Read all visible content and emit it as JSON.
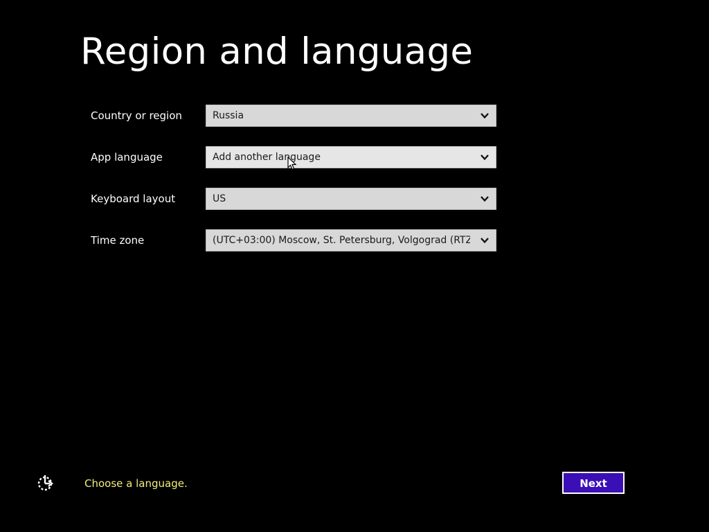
{
  "page": {
    "title": "Region and language"
  },
  "form": {
    "fields": [
      {
        "label": "Country or region",
        "value": "Russia"
      },
      {
        "label": "App language",
        "value": "Add another language"
      },
      {
        "label": "Keyboard layout",
        "value": "US"
      },
      {
        "label": "Time zone",
        "value": "(UTC+03:00) Moscow, St. Petersburg, Volgograd (RTZ..."
      }
    ]
  },
  "footer": {
    "status_text": "Choose a language.",
    "next_label": "Next",
    "ease_of_access_icon": "ease-of-access-icon"
  },
  "colors": {
    "background": "#000000",
    "status_text": "#f2ee7c",
    "next_button": "#3b0fb6",
    "dropdown": "#d8d8d8"
  }
}
